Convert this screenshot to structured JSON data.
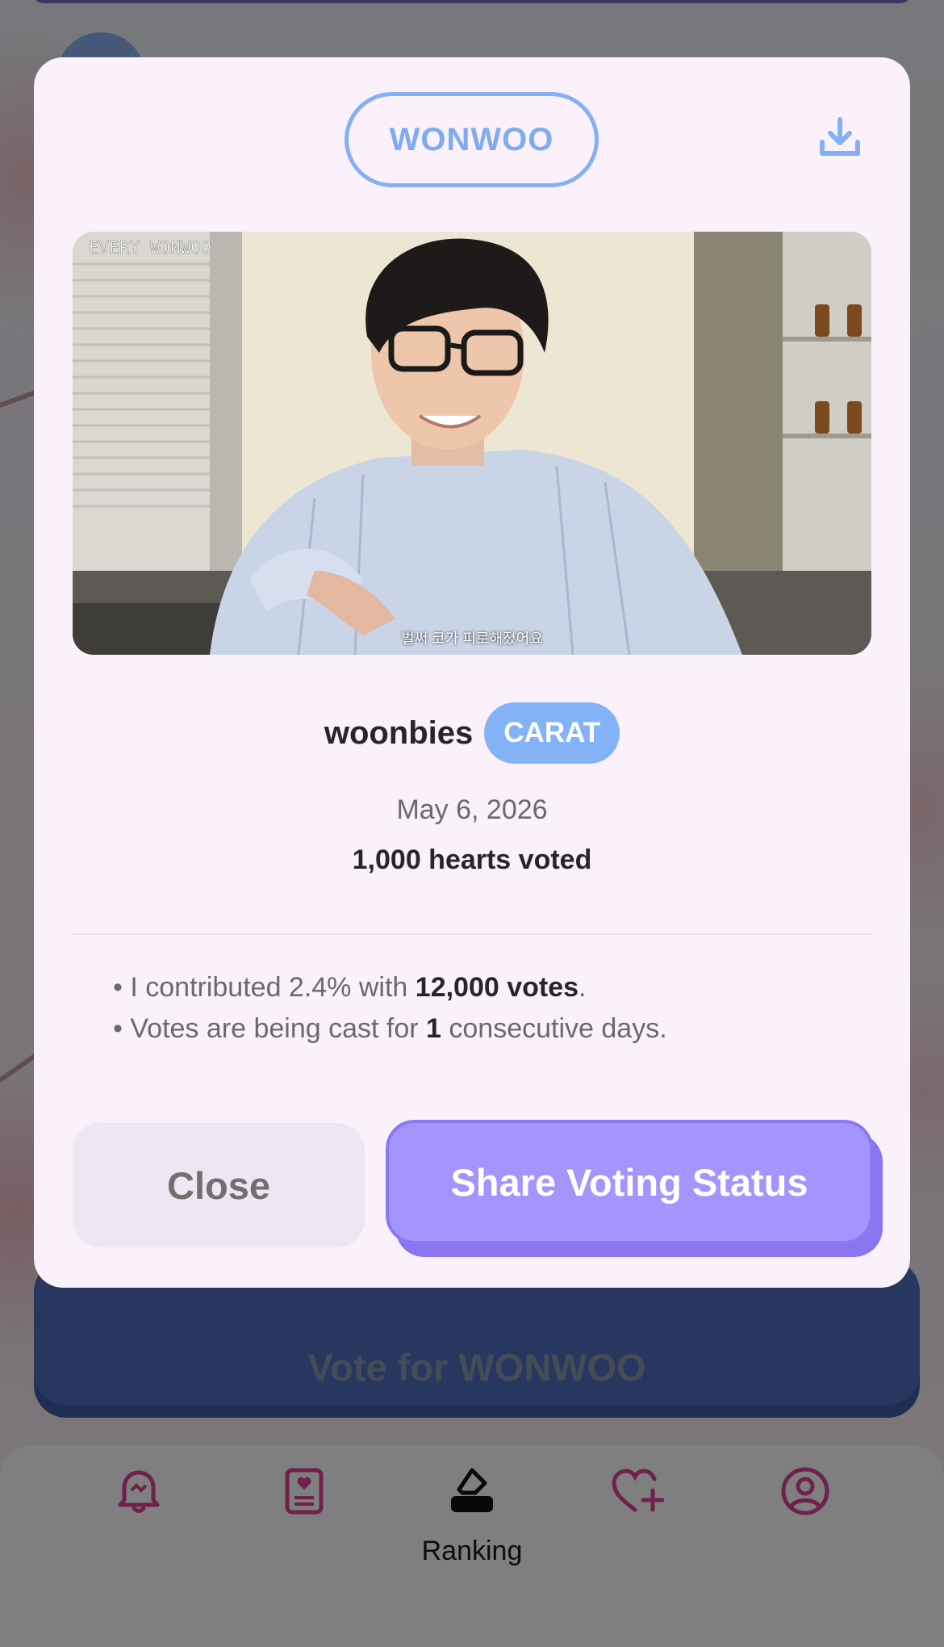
{
  "background": {
    "vote_button_label": "Vote for WONWOO",
    "tabs": [
      {
        "icon": "bell-icon",
        "label": ""
      },
      {
        "icon": "photocard-icon",
        "label": ""
      },
      {
        "icon": "ballot-box-icon",
        "label": "Ranking",
        "active": true
      },
      {
        "icon": "heart-plus-icon",
        "label": ""
      },
      {
        "icon": "profile-icon",
        "label": ""
      }
    ]
  },
  "modal": {
    "member_name": "WONWOO",
    "photo": {
      "watermark": "EVERY WONWOO",
      "subtitle": "벌써 코가 피로해졌어요"
    },
    "username": "woonbies",
    "role_badge": "CARAT",
    "date": "May 6, 2026",
    "hearts_voted": "1,000 hearts voted",
    "stats": {
      "line1_prefix": "I contributed 2.4% with ",
      "line1_bold": "12,000 votes",
      "line1_suffix": ".",
      "line2_prefix": "Votes are being cast for ",
      "line2_bold": "1",
      "line2_suffix": " consecutive days."
    },
    "close_label": "Close",
    "share_label": "Share Voting Status"
  },
  "colors": {
    "accent_blue": "#84b1f5",
    "accent_purple": "#a395fb",
    "modal_bg": "#faf1fb"
  }
}
